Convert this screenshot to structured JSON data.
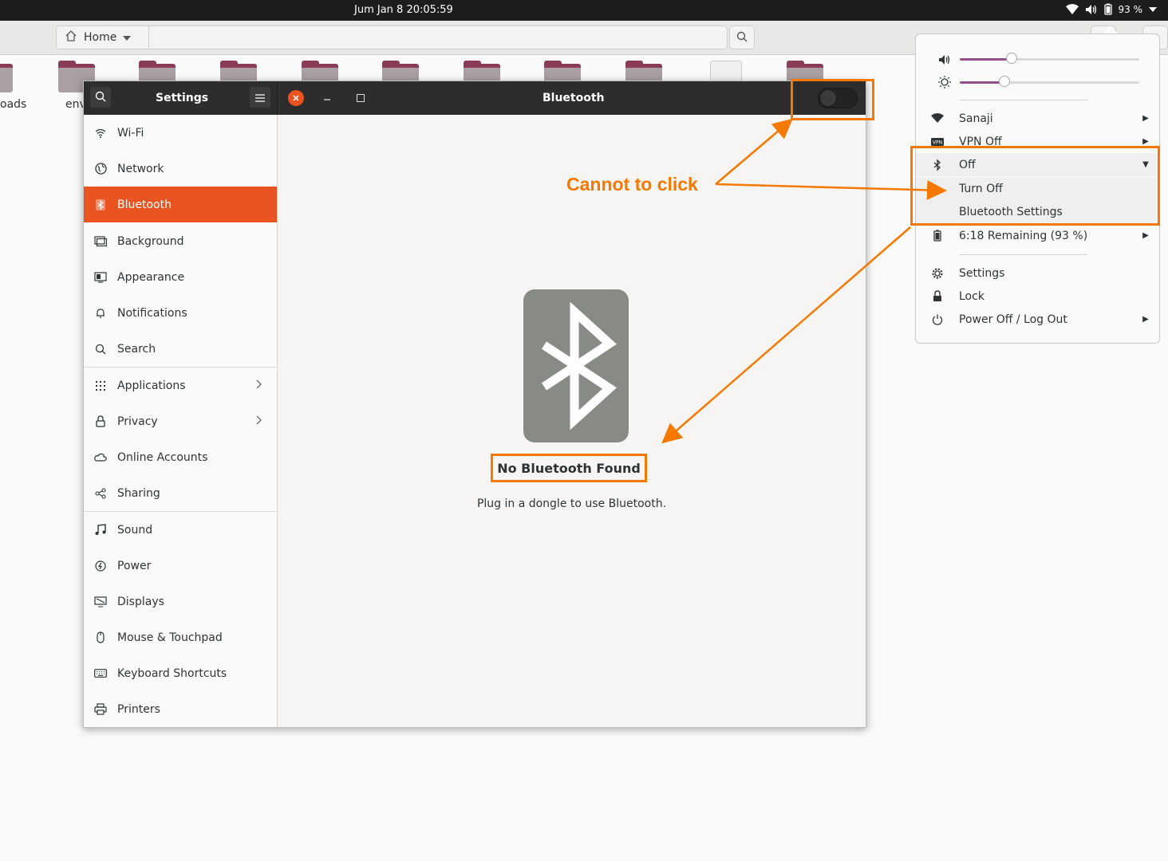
{
  "topbar": {
    "clock": "Jum Jan 8  20:05:59",
    "battery_percent": "93 %"
  },
  "file_manager": {
    "home_label": "Home",
    "labels": [
      "oads",
      "env"
    ]
  },
  "settings": {
    "title": "Settings",
    "panel_title": "Bluetooth",
    "bluetooth_toggle": false,
    "sidebar": [
      {
        "label": "Wi-Fi",
        "icon": "wifi-icon"
      },
      {
        "label": "Network",
        "icon": "network-icon"
      },
      {
        "label": "Bluetooth",
        "icon": "bluetooth-icon",
        "active": true
      },
      {
        "label": "Background",
        "icon": "background-icon"
      },
      {
        "label": "Appearance",
        "icon": "appearance-icon"
      },
      {
        "label": "Notifications",
        "icon": "bell-icon"
      },
      {
        "label": "Search",
        "icon": "search-icon"
      },
      {
        "label": "Applications",
        "icon": "grid-icon",
        "chevron": true
      },
      {
        "label": "Privacy",
        "icon": "lock-icon",
        "chevron": true
      },
      {
        "label": "Online Accounts",
        "icon": "cloud-icon"
      },
      {
        "label": "Sharing",
        "icon": "share-icon"
      },
      {
        "label": "Sound",
        "icon": "music-note-icon"
      },
      {
        "label": "Power",
        "icon": "power-icon"
      },
      {
        "label": "Displays",
        "icon": "display-icon"
      },
      {
        "label": "Mouse & Touchpad",
        "icon": "mouse-icon"
      },
      {
        "label": "Keyboard Shortcuts",
        "icon": "keyboard-icon"
      },
      {
        "label": "Printers",
        "icon": "printer-icon"
      }
    ],
    "empty_state": {
      "heading": "No Bluetooth Found",
      "description": "Plug in a dongle to use Bluetooth."
    }
  },
  "system_menu": {
    "volume_level": 0.29,
    "brightness_level": 0.25,
    "items": {
      "wifi": "Sanaji",
      "vpn": "VPN Off",
      "bluetooth": "Off",
      "bt_turn_off": "Turn Off",
      "bt_settings": "Bluetooth Settings",
      "battery": "6:18 Remaining (93 %)",
      "settings": "Settings",
      "lock": "Lock",
      "power": "Power Off / Log Out"
    }
  },
  "annotation": {
    "text": "Cannot to click",
    "color": "#f57900"
  },
  "colors": {
    "accent": "#e95420",
    "slider": "#924d8b",
    "headerbar": "#2d2d2d"
  }
}
